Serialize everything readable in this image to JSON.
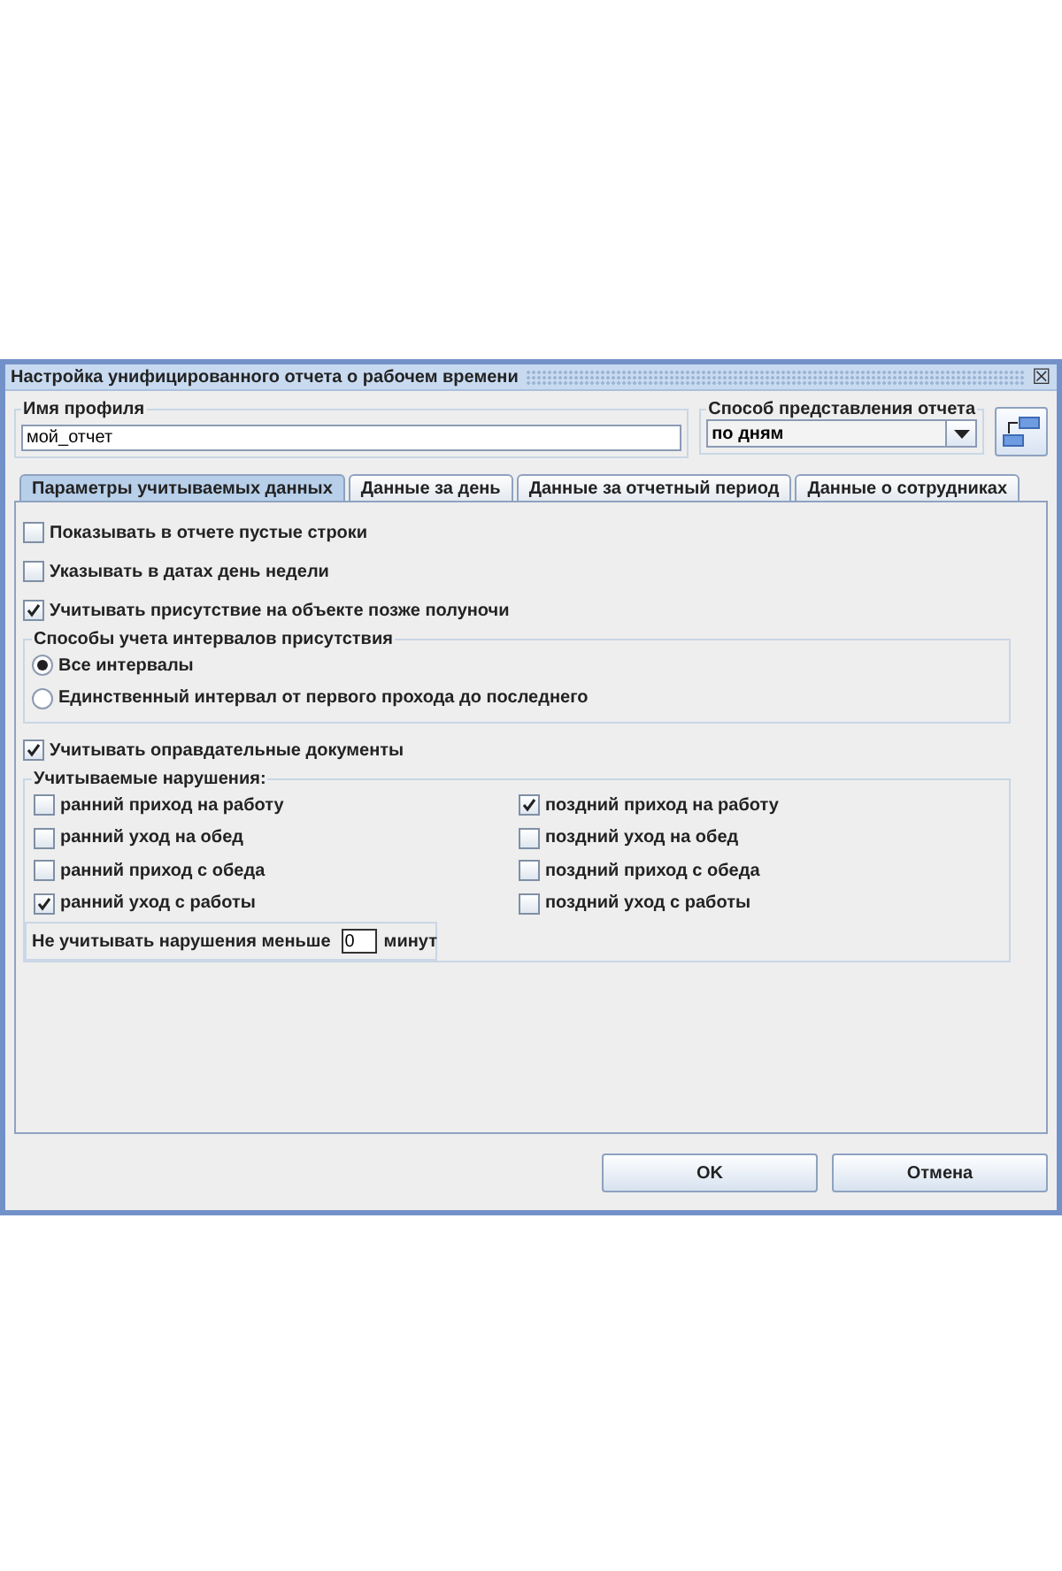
{
  "window": {
    "title": "Настройка унифицированного отчета о рабочем времени",
    "close": "☒"
  },
  "profile": {
    "label": "Имя профиля",
    "value": "мой_отчет"
  },
  "view_mode": {
    "label": "Способ представления отчета",
    "value": "по дням"
  },
  "tabs": [
    {
      "label": "Параметры учитываемых данных",
      "selected": true
    },
    {
      "label": "Данные за день",
      "selected": false
    },
    {
      "label": "Данные за отчетный период",
      "selected": false
    },
    {
      "label": "Данные о сотрудниках",
      "selected": false
    }
  ],
  "options_top": [
    {
      "label": "Показывать в отчете пустые строки",
      "checked": false
    },
    {
      "label": "Указывать в датах день недели",
      "checked": false
    },
    {
      "label": "Учитывать присутствие на объекте позже полуночи",
      "checked": true
    }
  ],
  "intervals": {
    "title": "Способы учета интервалов присутствия",
    "options": [
      {
        "label": "Все интервалы",
        "selected": true
      },
      {
        "label": "Единственный интервал от первого прохода до последнего",
        "selected": false
      }
    ]
  },
  "documents": {
    "label": "Учитывать оправдательные документы",
    "checked": true
  },
  "violations": {
    "title": "Учитываемые нарушения:",
    "left": [
      {
        "label": "ранний приход на работу",
        "checked": false
      },
      {
        "label": "ранний уход на обед",
        "checked": false
      },
      {
        "label": "ранний приход с обеда",
        "checked": false
      },
      {
        "label": "ранний уход с работы",
        "checked": true
      }
    ],
    "right": [
      {
        "label": "поздний приход на работу",
        "checked": true
      },
      {
        "label": "поздний уход на обед",
        "checked": false
      },
      {
        "label": "поздний приход с обеда",
        "checked": false
      },
      {
        "label": "поздний уход с работы",
        "checked": false
      }
    ],
    "threshold": {
      "label": "Не учитывать нарушения меньше",
      "value": "0",
      "unit": "минут"
    }
  },
  "buttons": [
    "OK",
    "Отмена"
  ]
}
